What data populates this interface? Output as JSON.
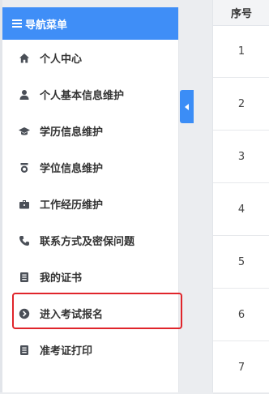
{
  "sidebar": {
    "title": "导航菜单",
    "items": [
      {
        "label": "个人中心",
        "icon": "home-icon"
      },
      {
        "label": "个人基本信息维护",
        "icon": "user-icon"
      },
      {
        "label": "学历信息维护",
        "icon": "graduation-cap-icon"
      },
      {
        "label": "学位信息维护",
        "icon": "medal-icon"
      },
      {
        "label": "工作经历维护",
        "icon": "briefcase-icon"
      },
      {
        "label": "联系方式及密保问题",
        "icon": "phone-icon"
      },
      {
        "label": "我的证书",
        "icon": "certificate-book-icon"
      },
      {
        "label": "进入考试报名",
        "icon": "chevron-circle-right-icon"
      },
      {
        "label": "准考证打印",
        "icon": "ticket-book-icon"
      }
    ]
  },
  "table": {
    "header": "序号",
    "rows": [
      "1",
      "2",
      "3",
      "4",
      "5",
      "6",
      "7"
    ]
  },
  "colors": {
    "header_blue": "#3f8ef7",
    "highlight_red": "#e0252b"
  }
}
